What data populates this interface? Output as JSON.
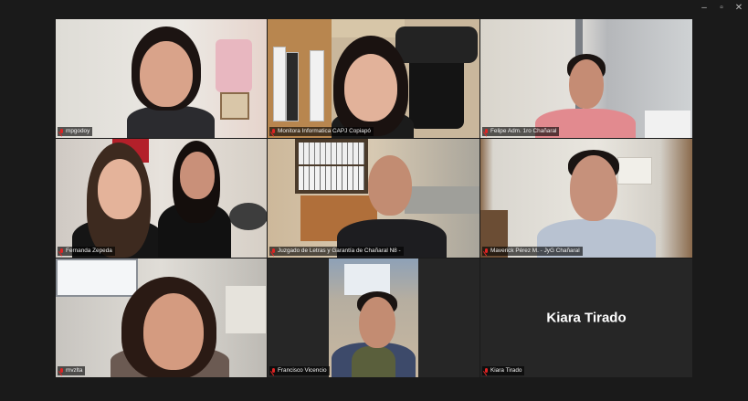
{
  "window": {
    "minimize_icon": "minimize-icon",
    "maximize_icon": "maximize-icon",
    "close_icon": "close-icon"
  },
  "participants": [
    {
      "name": "mpgodoy",
      "muted": true,
      "video": true
    },
    {
      "name": "Monitora Informatica CAPJ Copiapó",
      "muted": true,
      "video": true,
      "active_speaker": true
    },
    {
      "name": "Felipe Adm. 1ro Chañaral",
      "muted": true,
      "video": true
    },
    {
      "name": "Fernanda Zepeda",
      "muted": true,
      "video": true
    },
    {
      "name": "Juzgado de Letras y Garantía de Chañaral N8 -",
      "muted": true,
      "video": true
    },
    {
      "name": "Maverick Pérez M. - JyG Chañaral",
      "muted": true,
      "video": true
    },
    {
      "name": "mvzlta",
      "muted": true,
      "video": true
    },
    {
      "name": "Francisco Vicencio",
      "muted": true,
      "video": true
    },
    {
      "name": "Kiara Tirado",
      "display_name": "Kiara Tirado",
      "muted": true,
      "video": false
    }
  ],
  "colors": {
    "active_speaker_border": "#39d15b",
    "muted_icon": "#e02424",
    "background": "#1a1a1a"
  }
}
